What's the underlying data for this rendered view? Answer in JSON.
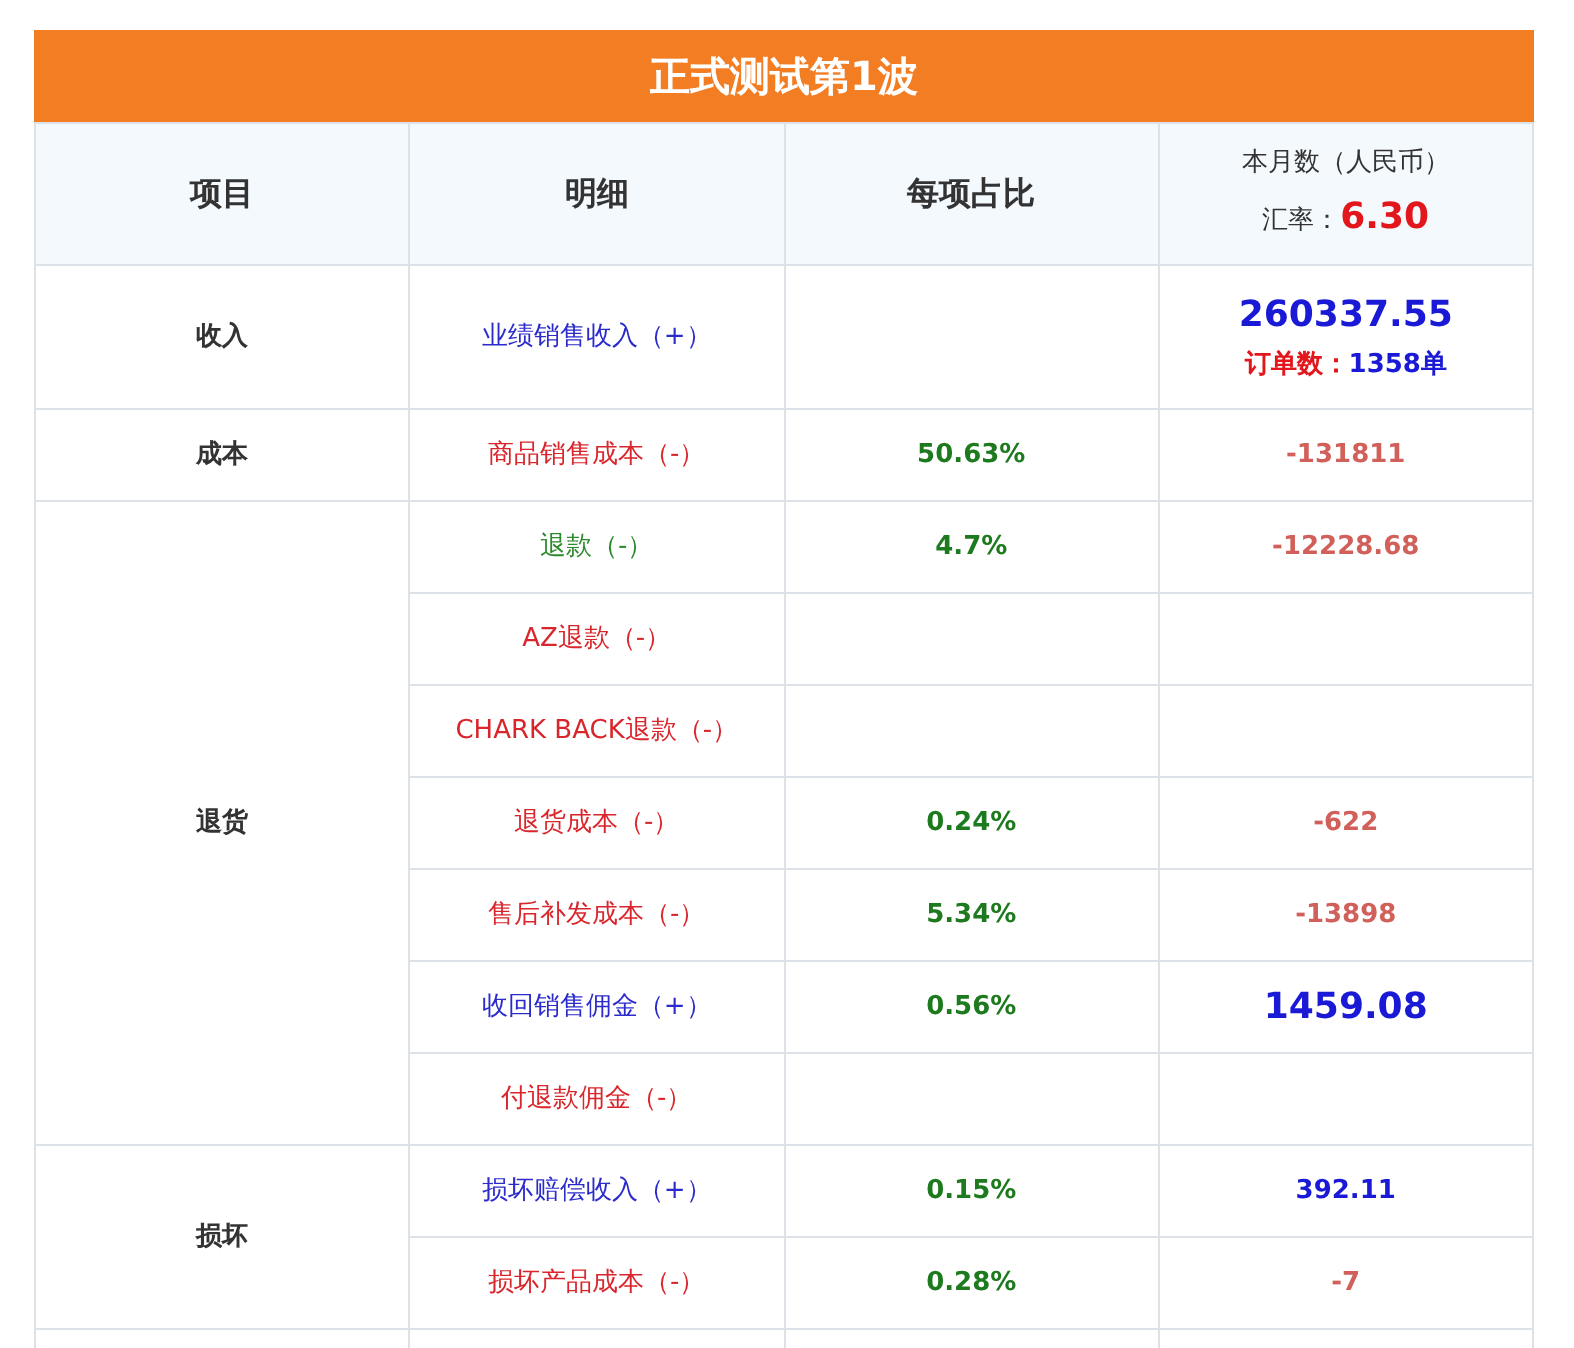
{
  "title": "正式测试第1波",
  "columns": [
    {
      "label": "项目"
    },
    {
      "label": "明细"
    },
    {
      "label": "每项占比"
    },
    {
      "label": "本月数（人民币）",
      "rate_label": "汇率：",
      "rate": "6.30"
    }
  ],
  "groups": [
    {
      "category": "收入",
      "rows": [
        {
          "detail": "业绩销售收入（+）",
          "color": "#2b2bcc",
          "kind": "income",
          "value": "260337.55",
          "orders_label": "订单数：",
          "orders": "1358单"
        }
      ]
    },
    {
      "category": "成本",
      "rows": [
        {
          "detail": "商品销售成本（-）",
          "color": "#d9262c",
          "share": "50.63%",
          "kind": "negative",
          "value": "-131811"
        }
      ]
    },
    {
      "category": "退货",
      "rows": [
        {
          "detail": "退款（-）",
          "color": "#2e8a2e",
          "share": "4.7%",
          "kind": "negative",
          "value": "-12228.68"
        },
        {
          "detail": "AZ退款（-）",
          "color": "#d9262c"
        },
        {
          "detail": "CHARK BACK退款（-）",
          "color": "#d9262c"
        },
        {
          "detail": "退货成本（-）",
          "color": "#d9262c",
          "share": "0.24%",
          "kind": "negative",
          "value": "-622"
        },
        {
          "detail": "售后补发成本（-）",
          "color": "#d9262c",
          "share": "5.34%",
          "kind": "negative",
          "value": "-13898"
        },
        {
          "detail": "收回销售佣金（+）",
          "color": "#2b2bcc",
          "share": "0.56%",
          "kind": "large",
          "value": "1459.08"
        },
        {
          "detail": "付退款佣金（-）",
          "color": "#d9262c"
        }
      ]
    },
    {
      "category": "损坏",
      "rows": [
        {
          "detail": "损坏赔偿收入（+）",
          "color": "#2b2bcc",
          "share": "0.15%",
          "kind": "positive",
          "value": "392.11"
        },
        {
          "detail": "损坏产品成本（-）",
          "color": "#d9262c",
          "share": "0.28%",
          "kind": "negative",
          "value": "-7"
        }
      ]
    }
  ]
}
